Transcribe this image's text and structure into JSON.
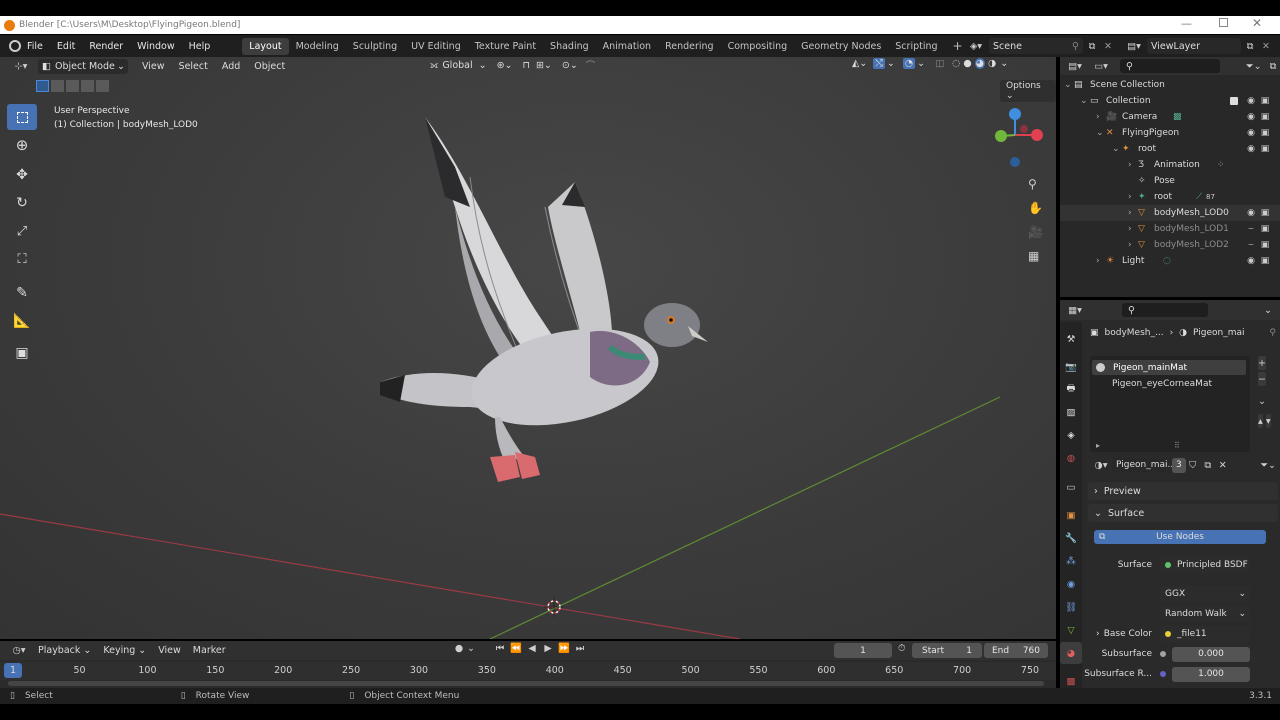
{
  "window": {
    "title": "Blender [C:\\Users\\M\\Desktop\\FlyingPigeon.blend]",
    "version": "3.3.1"
  },
  "menu": [
    "File",
    "Edit",
    "Render",
    "Window",
    "Help"
  ],
  "workspaces": [
    "Layout",
    "Modeling",
    "Sculpting",
    "UV Editing",
    "Texture Paint",
    "Shading",
    "Animation",
    "Rendering",
    "Compositing",
    "Geometry Nodes",
    "Scripting"
  ],
  "active_workspace": "Layout",
  "scene": "Scene",
  "view_layer": "ViewLayer",
  "viewport": {
    "mode": "Object Mode",
    "header_menus": [
      "View",
      "Select",
      "Add",
      "Object"
    ],
    "orientation": "Global",
    "options": "Options",
    "info_line1": "User Perspective",
    "info_line2": "(1) Collection | bodyMesh_LOD0",
    "gizmo_colors": {
      "x": "#e0404f",
      "y": "#6fb83c",
      "z": "#3f8ee0"
    }
  },
  "outliner": {
    "items": [
      {
        "label": "Scene Collection",
        "depth": 0,
        "icon": "scene-collection-icon"
      },
      {
        "label": "Collection",
        "depth": 1,
        "icon": "collection-icon"
      },
      {
        "label": "Camera",
        "depth": 2,
        "icon": "camera-icon"
      },
      {
        "label": "FlyingPigeon",
        "depth": 2,
        "icon": "empty-icon"
      },
      {
        "label": "root",
        "depth": 3,
        "icon": "armature-icon"
      },
      {
        "label": "Animation",
        "depth": 4,
        "icon": "animation-icon"
      },
      {
        "label": "Pose",
        "depth": 4,
        "icon": "pose-icon"
      },
      {
        "label": "root",
        "depth": 4,
        "icon": "armature-data-icon"
      },
      {
        "label": "bodyMesh_LOD0",
        "depth": 4,
        "icon": "mesh-icon"
      },
      {
        "label": "bodyMesh_LOD1",
        "depth": 4,
        "icon": "mesh-icon"
      },
      {
        "label": "bodyMesh_LOD2",
        "depth": 4,
        "icon": "mesh-icon"
      },
      {
        "label": "Light",
        "depth": 2,
        "icon": "light-icon"
      }
    ],
    "bone_count": "87"
  },
  "properties": {
    "breadcrumb_object": "bodyMesh_...",
    "breadcrumb_material": "Pigeon_mai",
    "material_slots": [
      "Pigeon_mainMat",
      "Pigeon_eyeCorneaMat"
    ],
    "material_name": "Pigeon_mai...",
    "user_count": "3",
    "panels": {
      "preview": "Preview",
      "surface": "Surface"
    },
    "use_nodes": "Use Nodes",
    "surface_label": "Surface",
    "surface_value": "Principled BSDF",
    "distribution": "GGX",
    "subsurface_method": "Random Walk",
    "base_color_label": "Base Color",
    "base_color_value": "_file11",
    "subsurface_label": "Subsurface",
    "subsurface_value": "0.000",
    "subsurface_r_label": "Subsurface R...",
    "subsurface_r_value": "1.000"
  },
  "timeline": {
    "menus": [
      "Playback",
      "Keying",
      "View",
      "Marker"
    ],
    "current_frame": "1",
    "start_label": "Start",
    "start": "1",
    "end_label": "End",
    "end": "760",
    "ticks": [
      "50",
      "100",
      "150",
      "200",
      "250",
      "300",
      "350",
      "400",
      "450",
      "500",
      "550",
      "600",
      "650",
      "700",
      "750"
    ],
    "tick_frames": [
      50,
      100,
      150,
      200,
      250,
      300,
      350,
      400,
      450,
      500,
      550,
      600,
      650,
      700,
      750
    ],
    "cursor_label": "1"
  },
  "statusbar": {
    "select": "Select",
    "rotate": "Rotate View",
    "context": "Object Context Menu"
  }
}
